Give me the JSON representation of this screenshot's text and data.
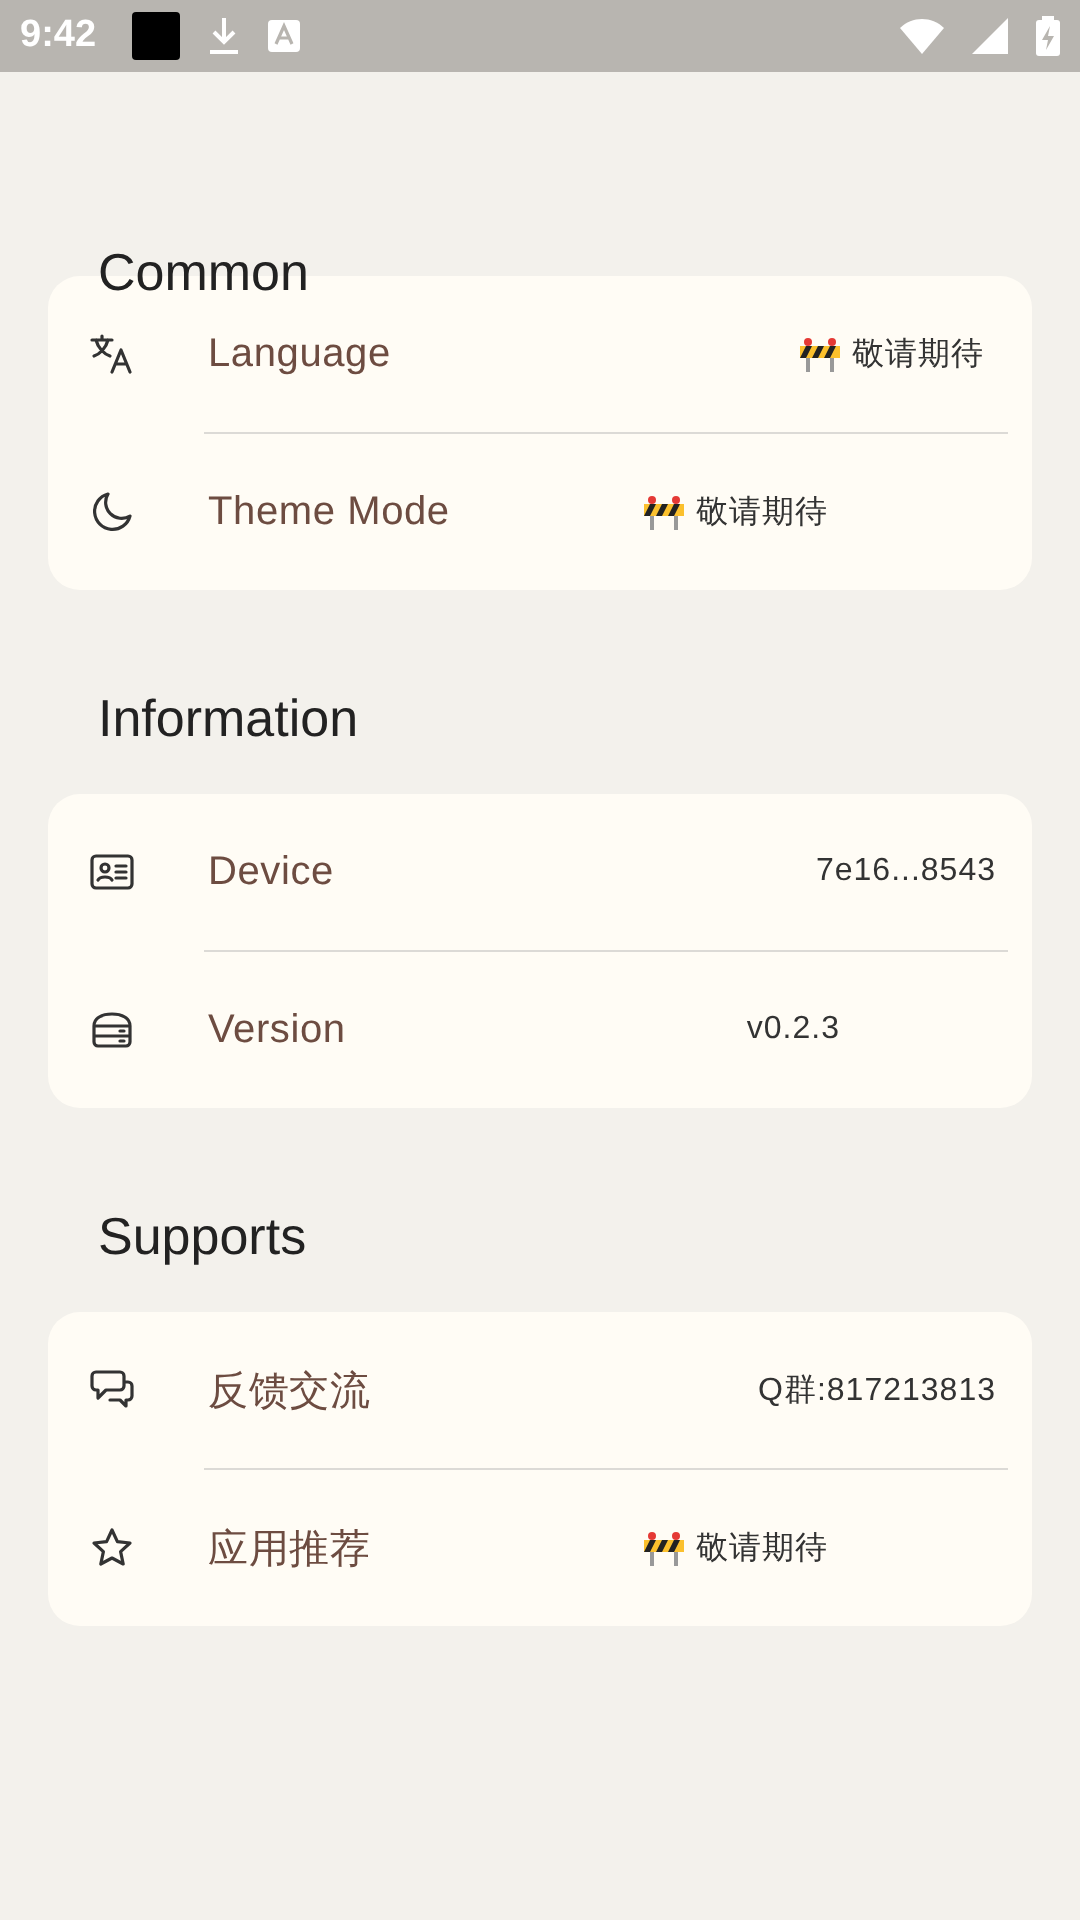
{
  "status_bar": {
    "time": "9:42"
  },
  "sections": [
    {
      "title": "Common",
      "rows": [
        {
          "label": "Language",
          "value": "敬请期待",
          "kind": "soon"
        },
        {
          "label": "Theme Mode",
          "value": "敬请期待",
          "kind": "soon"
        }
      ]
    },
    {
      "title": "Information",
      "rows": [
        {
          "label": "Device",
          "value": "7e16...8543",
          "kind": "text"
        },
        {
          "label": "Version",
          "value": "v0.2.3",
          "kind": "text"
        }
      ]
    },
    {
      "title": "Supports",
      "rows": [
        {
          "label": "反馈交流",
          "value": "Q群:817213813",
          "kind": "text"
        },
        {
          "label": "应用推荐",
          "value": "敬请期待",
          "kind": "soon"
        }
      ]
    }
  ]
}
